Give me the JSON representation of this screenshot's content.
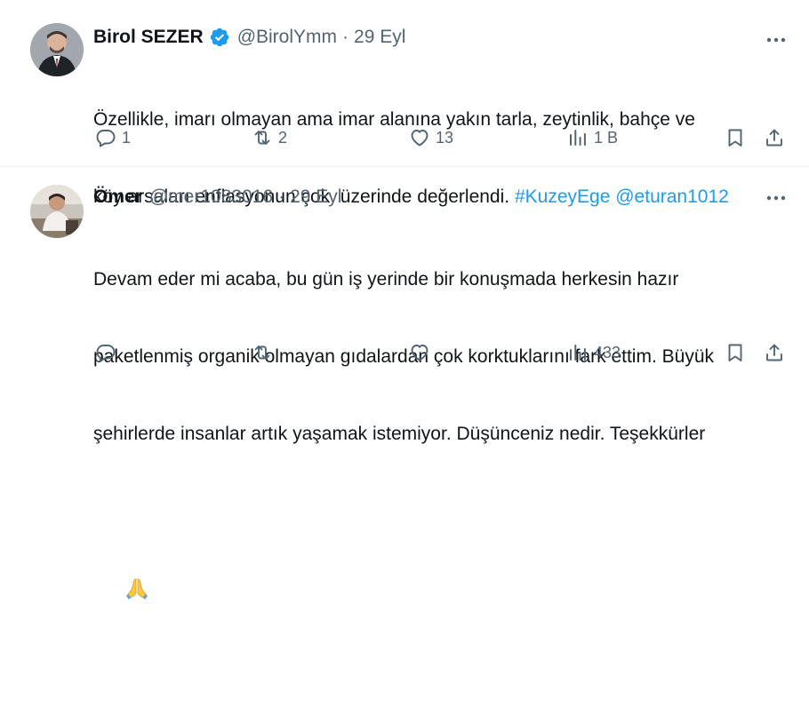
{
  "tweets": [
    {
      "name": "Birol SEZER",
      "verified": true,
      "handle": "@BirolYmm",
      "separator": "·",
      "time": "29 Eyl",
      "text_line1": "Özellikle, imarı olmayan ama imar alanına yakın tarla, zeytinlik, bahçe ve",
      "text_line2_plain": "köy arsaları enflasyonun çok  üzerinde değerlendi.",
      "hashtag": "#KuzeyEge",
      "mention": "@eturan1012",
      "replies": "1",
      "retweets": "2",
      "likes": "13",
      "views": "1 B"
    },
    {
      "name": "Ömer",
      "verified": false,
      "handle": "@mer1083016",
      "separator": "·",
      "time": "29 Eyl",
      "text_line1": "Devam eder mi acaba, bu gün iş yerinde bir konuşmada herkesin hazır",
      "text_line2": "paketlenmiş organik olmayan gıdalardan çok korktuklarını fark ettim. Büyük",
      "text_line3": "şehirlerde insanlar artık yaşamak istemiyor. Düşünceniz nedir. Teşekkürler",
      "emoji": "folded-hands",
      "replies": "",
      "retweets": "",
      "likes": "",
      "views": "433"
    }
  ],
  "colors": {
    "text": "#0f1419",
    "secondary": "#536471",
    "link": "#1d9bf0",
    "verified": "#1d9bf0",
    "divider": "#eff3f4"
  },
  "icons": [
    "verified-badge-icon",
    "more-icon",
    "reply-icon",
    "retweet-icon",
    "like-icon",
    "views-icon",
    "bookmark-icon",
    "share-icon",
    "folded-hands-emoji"
  ]
}
